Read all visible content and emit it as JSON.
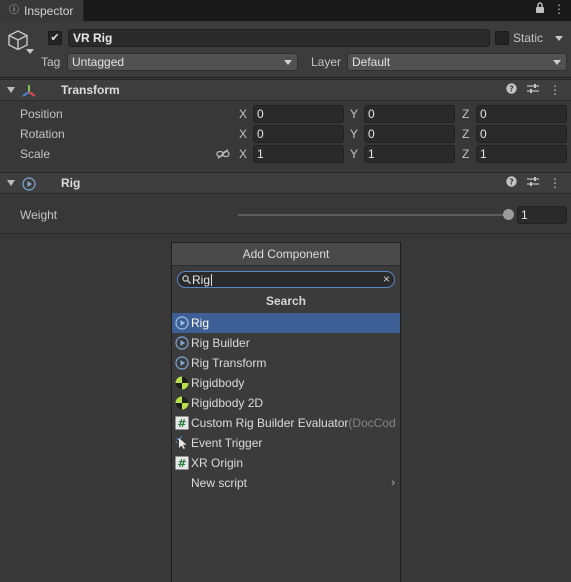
{
  "tab": {
    "title": "Inspector"
  },
  "header": {
    "active": true,
    "name": "VR Rig",
    "static_label": "Static",
    "tag_label": "Tag",
    "tag_value": "Untagged",
    "layer_label": "Layer",
    "layer_value": "Default"
  },
  "transform": {
    "title": "Transform",
    "rows": [
      {
        "label": "Position",
        "x": "0",
        "y": "0",
        "z": "0"
      },
      {
        "label": "Rotation",
        "x": "0",
        "y": "0",
        "z": "0"
      },
      {
        "label": "Scale",
        "x": "1",
        "y": "1",
        "z": "1"
      }
    ],
    "axis": {
      "x": "X",
      "y": "Y",
      "z": "Z"
    }
  },
  "rig": {
    "title": "Rig",
    "weight_label": "Weight",
    "weight_value": "1"
  },
  "popup": {
    "title": "Add Component",
    "search_value": "Rig",
    "section": "Search",
    "items": [
      {
        "label": "Rig",
        "icon": "rig-component-icon",
        "selected": true
      },
      {
        "label": "Rig Builder",
        "icon": "rig-component-icon"
      },
      {
        "label": "Rig Transform",
        "icon": "rig-component-icon"
      },
      {
        "label": "Rigidbody",
        "icon": "rigidbody-icon"
      },
      {
        "label": "Rigidbody 2D",
        "icon": "rigidbody-icon"
      },
      {
        "label": "Custom Rig Builder Evaluator",
        "suffix": "(DocCod",
        "icon": "script-icon"
      },
      {
        "label": "Event Trigger",
        "icon": "event-trigger-icon"
      },
      {
        "label": "XR Origin",
        "icon": "script-icon"
      },
      {
        "label": "New script",
        "icon": "chevron-right-icon"
      }
    ]
  },
  "colors": {
    "background": "#383838",
    "selection": "#3e5f96",
    "search_border": "#5a86c6"
  }
}
